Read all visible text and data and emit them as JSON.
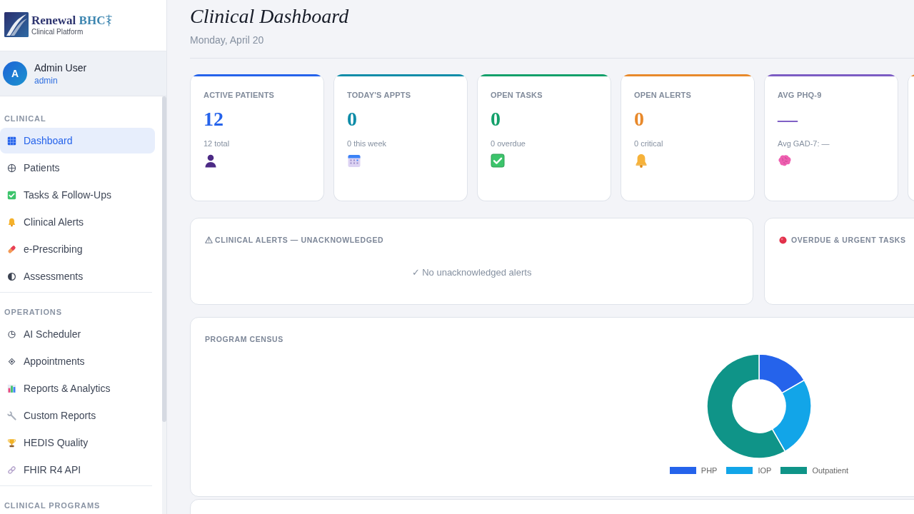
{
  "brand": {
    "name": "Renewal",
    "name_accent": "BHC",
    "tagline": "Clinical Platform"
  },
  "user": {
    "initial": "A",
    "name": "Admin User",
    "role": "admin"
  },
  "nav_sections": [
    {
      "title": "CLINICAL",
      "items": [
        {
          "label": "Dashboard",
          "selected": true
        },
        {
          "label": "Patients",
          "selected": false
        },
        {
          "label": "Tasks & Follow-Ups",
          "selected": false
        },
        {
          "label": "Clinical Alerts",
          "selected": false
        },
        {
          "label": "e-Prescribing",
          "selected": false
        },
        {
          "label": "Assessments",
          "selected": false
        }
      ]
    },
    {
      "title": "OPERATIONS",
      "items": [
        {
          "label": "AI Scheduler",
          "selected": false
        },
        {
          "label": "Appointments",
          "selected": false
        },
        {
          "label": "Reports & Analytics",
          "selected": false
        },
        {
          "label": "Custom Reports",
          "selected": false
        },
        {
          "label": "HEDIS Quality",
          "selected": false
        },
        {
          "label": "FHIR R4 API",
          "selected": false
        }
      ]
    },
    {
      "title": "CLINICAL PROGRAMS"
    }
  ],
  "header": {
    "title": "Clinical Dashboard",
    "date": "Monday, April 20"
  },
  "stat_cards": [
    {
      "label": "ACTIVE PATIENTS",
      "value": "12",
      "sub": "12 total",
      "color": "#2563eb"
    },
    {
      "label": "TODAY'S APPTS",
      "value": "0",
      "sub": "0 this week",
      "color": "#0e8ca8"
    },
    {
      "label": "OPEN TASKS",
      "value": "0",
      "sub": "0 overdue",
      "color": "#13a06a"
    },
    {
      "label": "OPEN ALERTS",
      "value": "0",
      "sub": "0 critical",
      "color": "#e8892b"
    },
    {
      "label": "AVG PHQ-9",
      "value": "—",
      "sub": "Avg GAD-7: —",
      "color": "#7c5cc4"
    },
    {
      "color": "#e8892b"
    }
  ],
  "alert_panels": [
    {
      "title": "CLINICAL ALERTS — UNACKNOWLEDGED",
      "empty_message": "✓ No unacknowledged alerts"
    },
    {
      "title": "OVERDUE & URGENT TASKS"
    }
  ],
  "census": {
    "title": "PROGRAM CENSUS",
    "chart_data": {
      "type": "donut",
      "categories": [
        "PHP",
        "IOP",
        "Outpatient"
      ],
      "values": [
        16.7,
        25,
        58.3
      ],
      "legend": "bottom"
    }
  }
}
